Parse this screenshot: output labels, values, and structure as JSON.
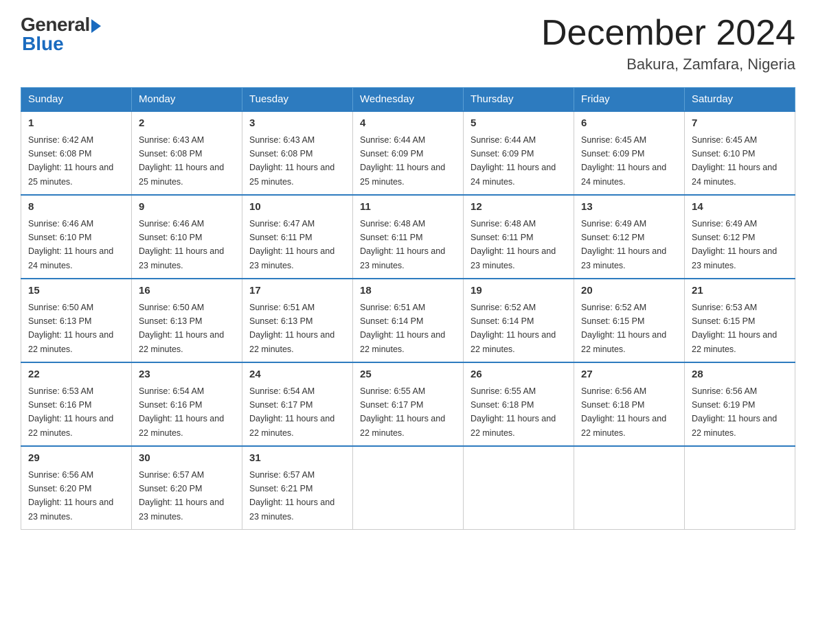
{
  "logo": {
    "general": "General",
    "blue": "Blue"
  },
  "title": "December 2024",
  "location": "Bakura, Zamfara, Nigeria",
  "headers": [
    "Sunday",
    "Monday",
    "Tuesday",
    "Wednesday",
    "Thursday",
    "Friday",
    "Saturday"
  ],
  "weeks": [
    [
      {
        "day": "1",
        "sunrise": "6:42 AM",
        "sunset": "6:08 PM",
        "daylight": "11 hours and 25 minutes."
      },
      {
        "day": "2",
        "sunrise": "6:43 AM",
        "sunset": "6:08 PM",
        "daylight": "11 hours and 25 minutes."
      },
      {
        "day": "3",
        "sunrise": "6:43 AM",
        "sunset": "6:08 PM",
        "daylight": "11 hours and 25 minutes."
      },
      {
        "day": "4",
        "sunrise": "6:44 AM",
        "sunset": "6:09 PM",
        "daylight": "11 hours and 25 minutes."
      },
      {
        "day": "5",
        "sunrise": "6:44 AM",
        "sunset": "6:09 PM",
        "daylight": "11 hours and 24 minutes."
      },
      {
        "day": "6",
        "sunrise": "6:45 AM",
        "sunset": "6:09 PM",
        "daylight": "11 hours and 24 minutes."
      },
      {
        "day": "7",
        "sunrise": "6:45 AM",
        "sunset": "6:10 PM",
        "daylight": "11 hours and 24 minutes."
      }
    ],
    [
      {
        "day": "8",
        "sunrise": "6:46 AM",
        "sunset": "6:10 PM",
        "daylight": "11 hours and 24 minutes."
      },
      {
        "day": "9",
        "sunrise": "6:46 AM",
        "sunset": "6:10 PM",
        "daylight": "11 hours and 23 minutes."
      },
      {
        "day": "10",
        "sunrise": "6:47 AM",
        "sunset": "6:11 PM",
        "daylight": "11 hours and 23 minutes."
      },
      {
        "day": "11",
        "sunrise": "6:48 AM",
        "sunset": "6:11 PM",
        "daylight": "11 hours and 23 minutes."
      },
      {
        "day": "12",
        "sunrise": "6:48 AM",
        "sunset": "6:11 PM",
        "daylight": "11 hours and 23 minutes."
      },
      {
        "day": "13",
        "sunrise": "6:49 AM",
        "sunset": "6:12 PM",
        "daylight": "11 hours and 23 minutes."
      },
      {
        "day": "14",
        "sunrise": "6:49 AM",
        "sunset": "6:12 PM",
        "daylight": "11 hours and 23 minutes."
      }
    ],
    [
      {
        "day": "15",
        "sunrise": "6:50 AM",
        "sunset": "6:13 PM",
        "daylight": "11 hours and 22 minutes."
      },
      {
        "day": "16",
        "sunrise": "6:50 AM",
        "sunset": "6:13 PM",
        "daylight": "11 hours and 22 minutes."
      },
      {
        "day": "17",
        "sunrise": "6:51 AM",
        "sunset": "6:13 PM",
        "daylight": "11 hours and 22 minutes."
      },
      {
        "day": "18",
        "sunrise": "6:51 AM",
        "sunset": "6:14 PM",
        "daylight": "11 hours and 22 minutes."
      },
      {
        "day": "19",
        "sunrise": "6:52 AM",
        "sunset": "6:14 PM",
        "daylight": "11 hours and 22 minutes."
      },
      {
        "day": "20",
        "sunrise": "6:52 AM",
        "sunset": "6:15 PM",
        "daylight": "11 hours and 22 minutes."
      },
      {
        "day": "21",
        "sunrise": "6:53 AM",
        "sunset": "6:15 PM",
        "daylight": "11 hours and 22 minutes."
      }
    ],
    [
      {
        "day": "22",
        "sunrise": "6:53 AM",
        "sunset": "6:16 PM",
        "daylight": "11 hours and 22 minutes."
      },
      {
        "day": "23",
        "sunrise": "6:54 AM",
        "sunset": "6:16 PM",
        "daylight": "11 hours and 22 minutes."
      },
      {
        "day": "24",
        "sunrise": "6:54 AM",
        "sunset": "6:17 PM",
        "daylight": "11 hours and 22 minutes."
      },
      {
        "day": "25",
        "sunrise": "6:55 AM",
        "sunset": "6:17 PM",
        "daylight": "11 hours and 22 minutes."
      },
      {
        "day": "26",
        "sunrise": "6:55 AM",
        "sunset": "6:18 PM",
        "daylight": "11 hours and 22 minutes."
      },
      {
        "day": "27",
        "sunrise": "6:56 AM",
        "sunset": "6:18 PM",
        "daylight": "11 hours and 22 minutes."
      },
      {
        "day": "28",
        "sunrise": "6:56 AM",
        "sunset": "6:19 PM",
        "daylight": "11 hours and 22 minutes."
      }
    ],
    [
      {
        "day": "29",
        "sunrise": "6:56 AM",
        "sunset": "6:20 PM",
        "daylight": "11 hours and 23 minutes."
      },
      {
        "day": "30",
        "sunrise": "6:57 AM",
        "sunset": "6:20 PM",
        "daylight": "11 hours and 23 minutes."
      },
      {
        "day": "31",
        "sunrise": "6:57 AM",
        "sunset": "6:21 PM",
        "daylight": "11 hours and 23 minutes."
      },
      null,
      null,
      null,
      null
    ]
  ]
}
